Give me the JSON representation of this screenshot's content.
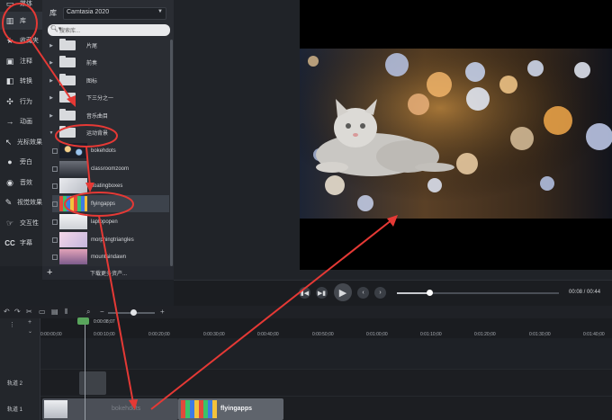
{
  "sidebar": {
    "items": [
      {
        "label": "媒体",
        "icon": "media-icon"
      },
      {
        "label": "库",
        "icon": "library-icon"
      },
      {
        "label": "收藏夹",
        "icon": "favorites-icon"
      },
      {
        "label": "注释",
        "icon": "annotation-icon"
      },
      {
        "label": "转换",
        "icon": "transition-icon"
      },
      {
        "label": "行为",
        "icon": "behavior-icon"
      },
      {
        "label": "动画",
        "icon": "animation-icon"
      },
      {
        "label": "光标效果",
        "icon": "cursor-effect-icon"
      },
      {
        "label": "旁白",
        "icon": "voice-narration-icon"
      },
      {
        "label": "音效",
        "icon": "audio-effect-icon"
      },
      {
        "label": "视觉效果",
        "icon": "visual-effect-icon"
      },
      {
        "label": "交互性",
        "icon": "interactivity-icon"
      },
      {
        "label": "字幕",
        "icon": "captions-icon"
      }
    ]
  },
  "library": {
    "title": "库",
    "selected_library": "Camtasia 2020",
    "search_placeholder": "搜索库...",
    "folders": [
      "片尾",
      "前奏",
      "图标",
      "下三分之一",
      "音乐曲目",
      "运动背景"
    ],
    "media": [
      "bokehdots",
      "classroomzoom",
      "floatingboxes",
      "flyingapps",
      "laptopopen",
      "morphingtriangles",
      "mountaindawn"
    ],
    "selected_media": "flyingapps",
    "footer_link": "下载更多资产..."
  },
  "transport": {
    "timecode": "00:08 / 00:44",
    "playback_progress": 0.2
  },
  "timeline": {
    "playhead_time": "0:00:08;07",
    "ruler_ticks": [
      "0:00:00;00",
      "0:00:10;00",
      "0:00:20;00",
      "0:00:30;00",
      "0:00:40;00",
      "0:00:50;00",
      "0:01:00;00",
      "0:01:10;00",
      "0:01:20;00",
      "0:01:30;00",
      "0:01:40;00"
    ],
    "tracks": [
      "轨道 2",
      "轨道 1"
    ],
    "clips": [
      {
        "label": "bokehdots",
        "track": "轨道 1"
      },
      {
        "label": "flyingapps",
        "track": "轨道 1"
      }
    ]
  },
  "colors": {
    "annotation_red": "#e53935",
    "playhead_green": "#59a55c"
  }
}
